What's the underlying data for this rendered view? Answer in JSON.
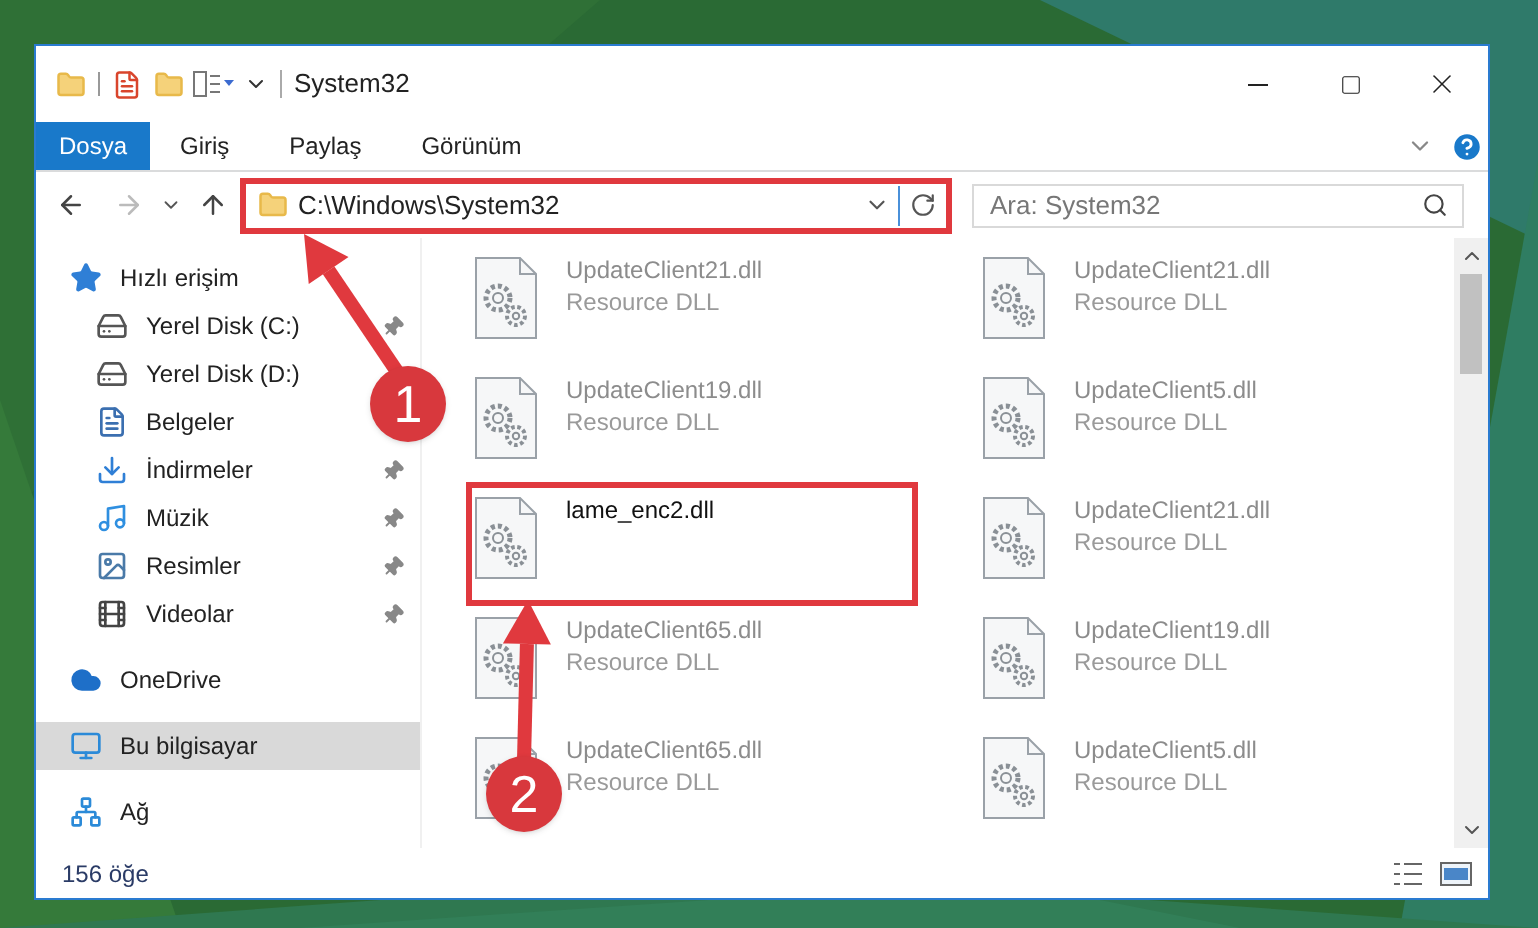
{
  "window": {
    "title": "System32"
  },
  "ribbon_tabs": [
    {
      "label": "Dosya",
      "kind": "file"
    },
    {
      "label": "Giriş",
      "kind": "tab"
    },
    {
      "label": "Paylaş",
      "kind": "tab"
    },
    {
      "label": "Görünüm",
      "kind": "tab"
    }
  ],
  "address": {
    "path": "C:\\Windows\\System32"
  },
  "search": {
    "placeholder": "Ara: System32"
  },
  "sidebar": {
    "items": [
      {
        "label": "Hızlı erişim",
        "kind": "star",
        "selected": false,
        "children": [
          {
            "label": "Yerel Disk (C:)",
            "kind": "drive",
            "pinned": true
          },
          {
            "label": "Yerel Disk (D:)",
            "kind": "drive",
            "pinned": false
          },
          {
            "label": "Belgeler",
            "kind": "docs",
            "pinned": false
          },
          {
            "label": "İndirmeler",
            "kind": "download",
            "pinned": true
          },
          {
            "label": "Müzik",
            "kind": "music",
            "pinned": true
          },
          {
            "label": "Resimler",
            "kind": "pictures",
            "pinned": true
          },
          {
            "label": "Videolar",
            "kind": "videos",
            "pinned": true
          }
        ]
      },
      {
        "label": "OneDrive",
        "kind": "cloud",
        "selected": false
      },
      {
        "label": "Bu bilgisayar",
        "kind": "computer",
        "selected": true
      },
      {
        "label": "Ağ",
        "kind": "network",
        "selected": false
      }
    ]
  },
  "files": [
    {
      "name": "UpdateClient21.dll",
      "description": "Resource DLL",
      "faded": true
    },
    {
      "name": "UpdateClient21.dll",
      "description": "Resource DLL",
      "faded": true
    },
    {
      "name": "UpdateClient19.dll",
      "description": "Resource DLL",
      "faded": true
    },
    {
      "name": "UpdateClient5.dll",
      "description": "Resource DLL",
      "faded": true
    },
    {
      "name": "lame_enc2.dll",
      "faded": false,
      "highlighted": true
    },
    {
      "name": "UpdateClient21.dll",
      "description": "Resource DLL",
      "faded": true
    },
    {
      "name": "UpdateClient65.dll",
      "description": "Resource DLL",
      "faded": true
    },
    {
      "name": "UpdateClient19.dll",
      "description": "Resource DLL",
      "faded": true
    },
    {
      "name": "UpdateClient65.dll",
      "description": "Resource DLL",
      "faded": true
    },
    {
      "name": "UpdateClient5.dll",
      "description": "Resource DLL",
      "faded": true
    }
  ],
  "annotations": [
    {
      "label": "1"
    },
    {
      "label": "2"
    }
  ],
  "status_bar": {
    "count": "156 öğe"
  }
}
